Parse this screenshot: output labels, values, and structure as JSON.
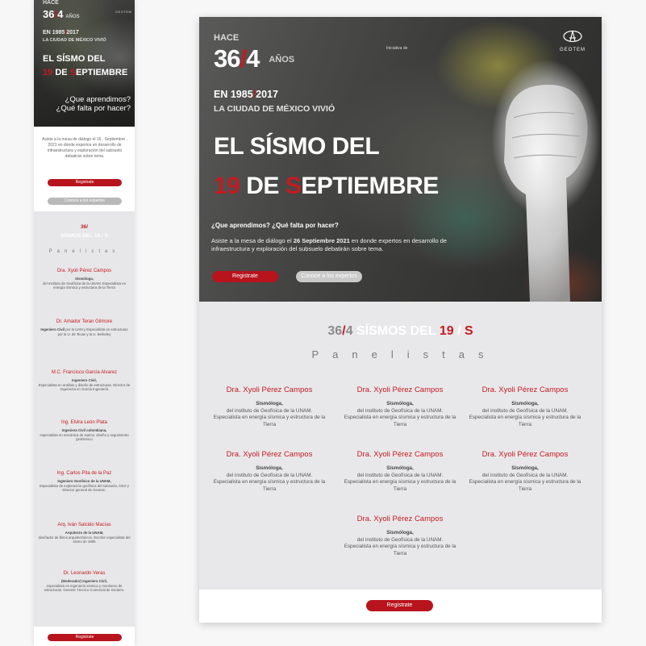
{
  "hero": {
    "hace": "HACE",
    "years_a": "36",
    "years_sep": "/",
    "years_b": "4",
    "anos": "AÑOS",
    "en_prefix": "EN",
    "year_a": "1985",
    "year_sep": "/",
    "year_b": "2017",
    "ciudad": "LA CIUDAD DE MÉXICO VIVIÓ",
    "title_line1": "EL SÍSMO DEL",
    "title_num": "19",
    "title_de": "DE",
    "title_s": "S",
    "title_rest": "EPTIEMBRE",
    "question": "¿Que aprendimos? ¿Qué falta por hacer?",
    "desc_pre": "Asiste a la mesa de diálogo el",
    "desc_day": "26",
    "desc_month": "Septiembre",
    "desc_year": "2021",
    "desc_post": "en donde expertos en desarrollo de infraestructura y exploración del subsuelo debatirán sobre tema.",
    "initiative": "Iniciativa de",
    "logo_word": "GEOTEM",
    "btn_register": "Registrate",
    "btn_experts": "Conoce a los expertos"
  },
  "mobile": {
    "question_1": "¿Que aprendimos?",
    "question_2": "¿Qué falta por hacer?",
    "intro": "Asiste a la mesa de diálogo el 16 , Septiembre , 2021 en donde expertos en desarrollo de infraestructura y exploración del subsuelo debatirán sobre tema.",
    "btn_experts": "Conoce a los expertos",
    "head1": "36/",
    "head2": "SÍSMOS DEL 19 / S",
    "panelists": [
      {
        "name": "Dra. Xyoli Pérez Campos",
        "role": "Sismóloga,",
        "desc": "del Instituto de Geofísica de la UNAM. Especialista en energía sísmica y estructura de la Tierra"
      },
      {
        "name": "Dr. Amador Teran Gilmore",
        "role": "Ingeniero Civil",
        "desc": "por la UAM y Especialista en estructuras por la U. de Texas y la U. Berkeley"
      },
      {
        "name": "M.C. Francisco García Alvarez",
        "role": "Ingeniero Civil,",
        "desc": "Especialista en análisis y diseño de estructuras. Director de Ingeniería en García Ingeniería"
      },
      {
        "name": "Ing. Elvira León Plata",
        "role": "Ingeniera Civil colombiana,",
        "desc": "especialista en mecánica de suelos, diseño y seguimiento geotécnico"
      },
      {
        "name": "Ing. Carlos Pita de la Paz",
        "role": "Ingeniero Geofísico de la UNAM,",
        "desc": "Especialista de exploración geofísica del subsuelo, CEO y Director general de Geotem."
      },
      {
        "name": "Arq. Iván Salcido Macías",
        "role": "Arquitecto de la UNAM,",
        "desc": "diseñador de libros arquitectónicos. Escritor especialista del sismo de 1985"
      },
      {
        "name": "Dr. Leonardo Veras",
        "role": "(Moderador) Ingeniero Civil,",
        "desc": "especialista en ingeniería sísmica y monitoreo de estructuras. Gerente Técnico Comercial de Geotem."
      }
    ],
    "footer_btn": "Registrate"
  },
  "desktop_panel": {
    "head_a": "36",
    "head_sep": "/",
    "head_b": "4",
    "head_mid": "SÍSMOS DEL",
    "head_num": "19",
    "head_sep2": "/",
    "head_s": "S",
    "panelistas": "Panelistas",
    "cards": [
      {
        "name": "Dra. Xyoli Pérez Campos",
        "role": "Sismóloga,",
        "desc": "del instituto de Geofísica de la UNAM. Especialista en energía sísmica y estructura de la Tierra"
      },
      {
        "name": "Dra. Xyoli Pérez Campos",
        "role": "Sismóloga,",
        "desc": "del instituto de Geofísica de la UNAM. Especialista en energía sísmica y estructura de la Tierra"
      },
      {
        "name": "Dra. Xyoli Pérez Campos",
        "role": "Sismóloga,",
        "desc": "del instituto de Geofísica de la UNAM. Especialista en energía sísmica y estructura de la Tierra"
      },
      {
        "name": "Dra. Xyoli Pérez Campos",
        "role": "Sismóloga,",
        "desc": "del instituto de Geofísica de la UNAM. Especialista en energía sísmica y estructura de la Tierra"
      },
      {
        "name": "Dra. Xyoli Pérez Campos",
        "role": "Sismóloga,",
        "desc": "del instituto de Geofísica de la UNAM. Especialista en energía sísmica y estructura de la Tierra"
      },
      {
        "name": "Dra. Xyoli Pérez Campos",
        "role": "Sismóloga,",
        "desc": "del instituto de Geofísica de la UNAM. Especialista en energía sísmica y estructura de la Tierra"
      },
      {
        "name": "Dra. Xyoli Pérez Campos",
        "role": "Sismóloga,",
        "desc": "del instituto de Geofísica de la UNAM. Especialista en energía sísmica y estructura de la Tierra"
      }
    ],
    "footer_btn": "Registrate"
  },
  "colors": {
    "accent_red": "#c41a21",
    "button_red": "#b8141d",
    "panel_grey": "#e8e8ea"
  },
  "icons": {
    "logo": "geotem-logo-icon"
  }
}
